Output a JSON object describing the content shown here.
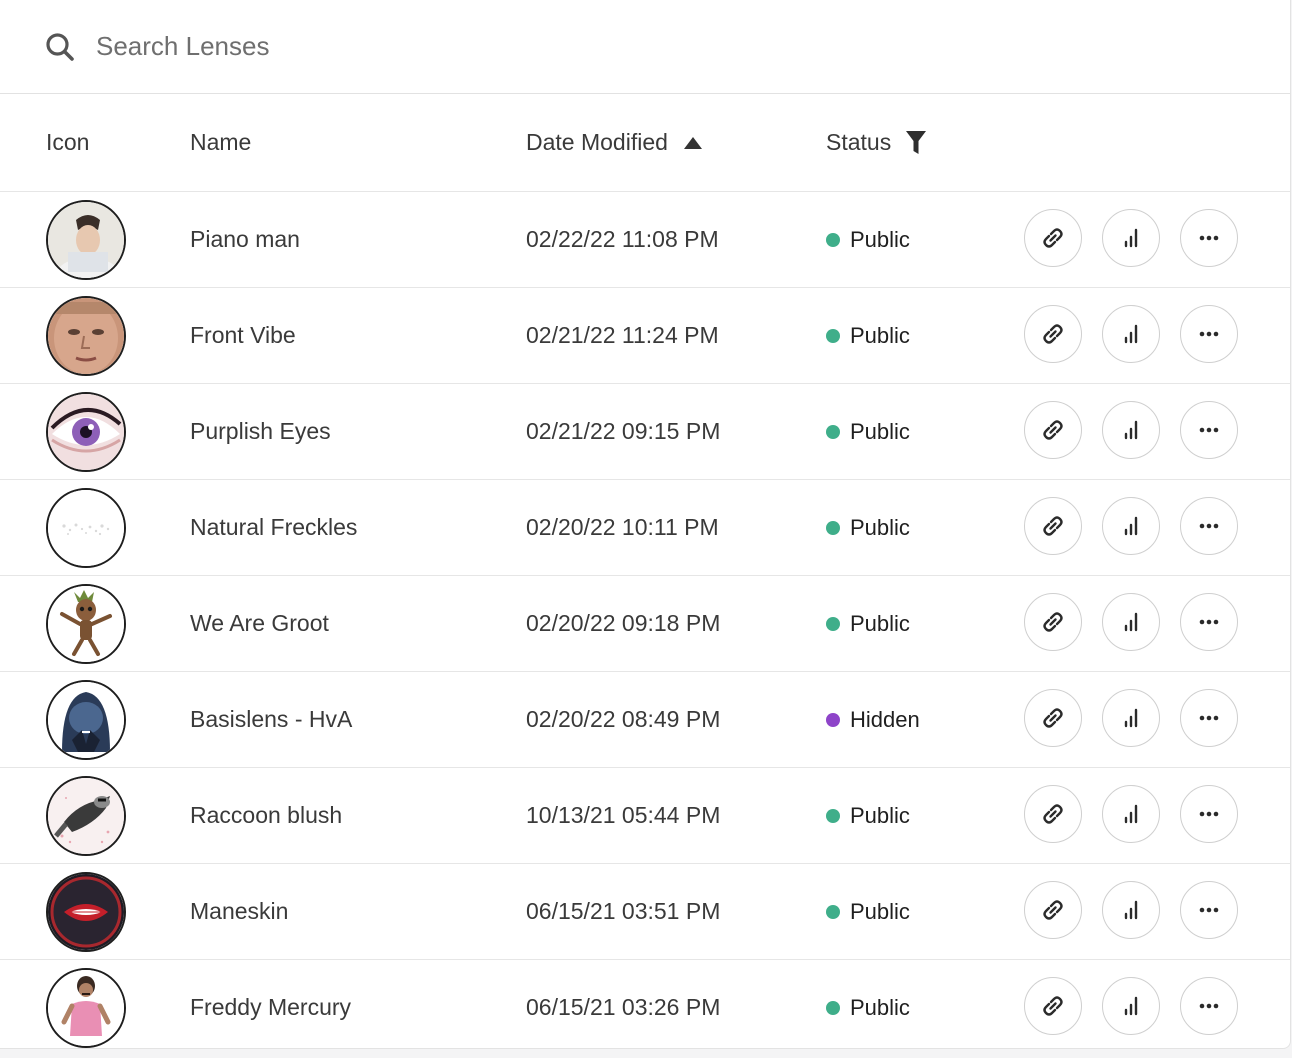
{
  "search": {
    "placeholder": "Search Lenses"
  },
  "table": {
    "headers": {
      "icon": "Icon",
      "name": "Name",
      "date": "Date Modified",
      "status": "Status"
    },
    "sort_indicator": "ascending",
    "rows": [
      {
        "name": "Piano man",
        "date": "02/22/22 11:08 PM",
        "status": "Public",
        "status_color": "#3fae8a",
        "avatar": "portrait-man"
      },
      {
        "name": "Front Vibe",
        "date": "02/21/22 11:24 PM",
        "status": "Public",
        "status_color": "#3fae8a",
        "avatar": "face-closeup"
      },
      {
        "name": "Purplish Eyes",
        "date": "02/21/22 09:15 PM",
        "status": "Public",
        "status_color": "#3fae8a",
        "avatar": "purple-eye"
      },
      {
        "name": "Natural Freckles",
        "date": "02/20/22 10:11 PM",
        "status": "Public",
        "status_color": "#3fae8a",
        "avatar": "freckles"
      },
      {
        "name": "We Are Groot",
        "date": "02/20/22 09:18 PM",
        "status": "Public",
        "status_color": "#3fae8a",
        "avatar": "groot"
      },
      {
        "name": "Basislens - HvA",
        "date": "02/20/22 08:49 PM",
        "status": "Hidden",
        "status_color": "#8e44c9",
        "avatar": "hooded-figure"
      },
      {
        "name": "Raccoon blush",
        "date": "10/13/21 05:44 PM",
        "status": "Public",
        "status_color": "#3fae8a",
        "avatar": "raccoon"
      },
      {
        "name": "Maneskin",
        "date": "06/15/21 03:51 PM",
        "status": "Public",
        "status_color": "#3fae8a",
        "avatar": "maneskin-lips"
      },
      {
        "name": "Freddy Mercury",
        "date": "06/15/21 03:26 PM",
        "status": "Public",
        "status_color": "#3fae8a",
        "avatar": "freddy-figure"
      }
    ]
  },
  "row_actions": [
    "link-icon",
    "stats-icon",
    "more-icon"
  ]
}
